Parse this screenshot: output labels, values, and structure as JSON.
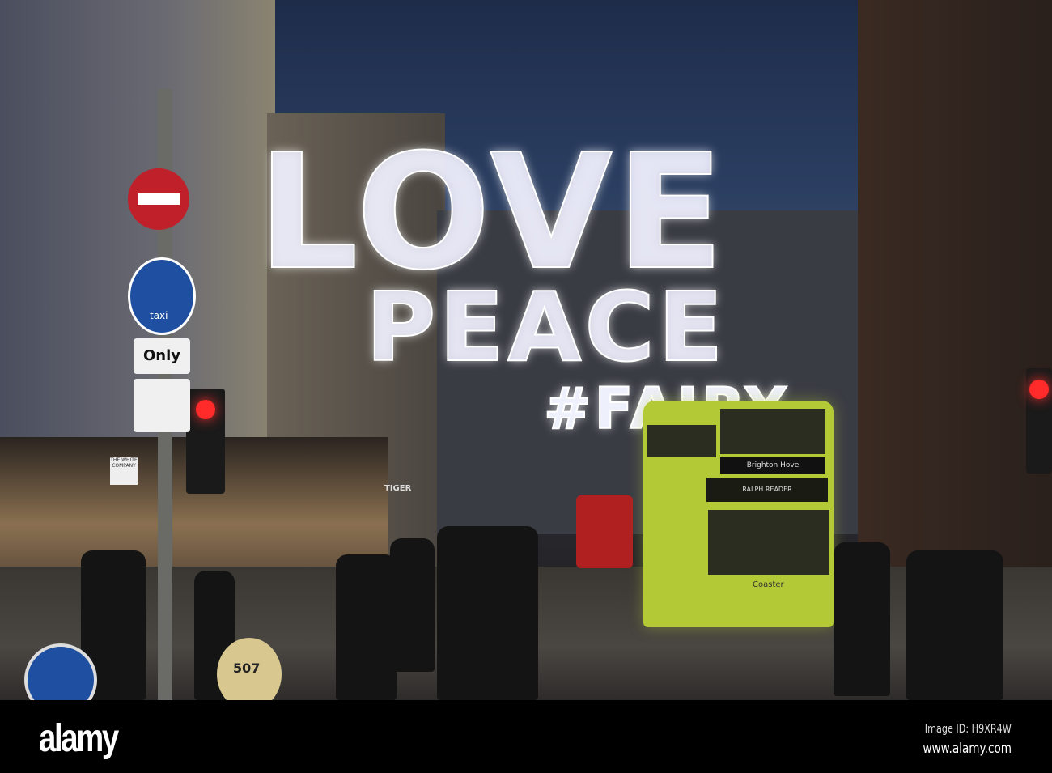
{
  "photo": {
    "lights_line1": "LOVE",
    "lights_line2": "PEACE",
    "lights_line3": "#FAIRY",
    "bus_destination": "Brighton Hove",
    "bus_name": "RALPH READER",
    "bus_brand": "Coaster",
    "sign_only": "Only",
    "sign_taxi": "taxi",
    "bollard_number": "507",
    "shop_name": "THE WHITE COMPANY",
    "shop_tiger": "TIGER"
  },
  "footer": {
    "logo": "alamy",
    "image_id": "Image ID: H9XR4W",
    "website": "www.alamy.com"
  }
}
